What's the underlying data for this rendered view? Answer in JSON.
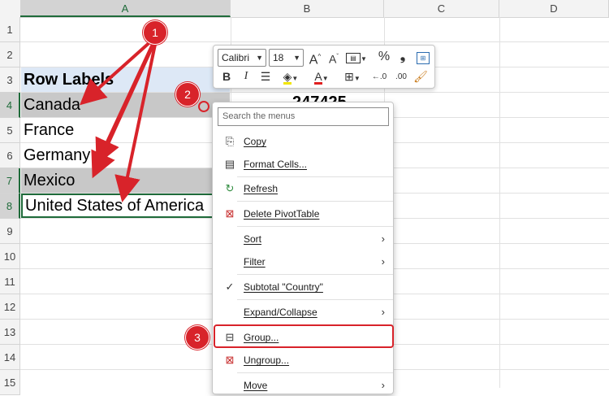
{
  "columns": [
    "A",
    "B",
    "C",
    "D"
  ],
  "rows": [
    "1",
    "2",
    "3",
    "4",
    "5",
    "6",
    "7",
    "8",
    "9",
    "10",
    "11",
    "12",
    "13",
    "14",
    "15"
  ],
  "cells": {
    "a3": "Row Labels",
    "a4": "Canada",
    "a5": "France",
    "a6": "Germany",
    "a7": "Mexico",
    "a8": "United States of America",
    "b4": "247425"
  },
  "mini_toolbar": {
    "font_name": "Calibri",
    "font_size": "18",
    "grow_font": "A",
    "shrink_font": "A",
    "percent": "%",
    "comma": "❩",
    "bold": "B",
    "italic": "I",
    "font_color_letter": "A",
    "decrease_decimal": "←.0",
    "increase_decimal": ".00"
  },
  "context_menu": {
    "search_placeholder": "Search the menus",
    "items": {
      "copy": "Copy",
      "format_cells": "Format Cells...",
      "refresh": "Refresh",
      "delete_pivot": "Delete PivotTable",
      "sort": "Sort",
      "filter": "Filter",
      "subtotal": "Subtotal \"Country\"",
      "expand_collapse": "Expand/Collapse",
      "group": "Group...",
      "ungroup": "Ungroup...",
      "move": "Move"
    }
  },
  "callouts": [
    "1",
    "2",
    "3"
  ],
  "colors": {
    "accent_green": "#1f6b3a",
    "callout_red": "#d8232a",
    "header_blue": "#dde8f6",
    "selection_gray": "#c8c8c8"
  }
}
